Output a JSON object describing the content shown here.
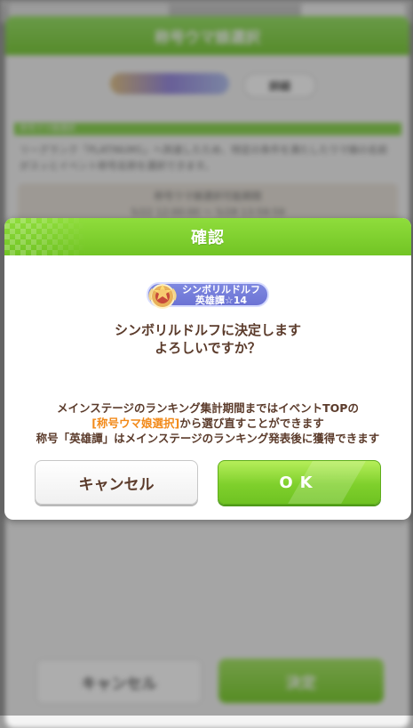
{
  "background_dialog": {
    "title": "称号ウマ娘選択",
    "detail_button": "詳細",
    "section_label": "称号ウマ娘選択",
    "description": "リーグランク「PLATINUM1」へ到達したため、特定の条件を満たしたウマ娘の名前がスッとイベント称号名称を選択できます。",
    "period_label": "称号ウマ娘選択可能期間",
    "period_value": "5/22 12:00:00 ～ 5/28 13:59:59",
    "cancel_button": "キャンセル",
    "confirm_button": "決定"
  },
  "modal": {
    "title": "確認",
    "badge": {
      "name": "シンボリルドルフ",
      "rank": "英雄譚☆14"
    },
    "confirm_line1": "シンボリルドルフに決定します",
    "confirm_line2": "よろしいですか？",
    "notice_line1": "メインステージのランキング集計期間まではイベントTOPの",
    "notice_link": "[称号ウマ娘選択]",
    "notice_line2_rest": "から選び直すことができます",
    "notice_line3": "称号「英雄譚」はメインステージのランキング発表後に獲得できます",
    "cancel_button": "キャンセル",
    "ok_button": "OK"
  },
  "colors": {
    "header_green": "#7fcd3f",
    "ok_green": "#7fd02c",
    "text_brown": "#5b3b2b",
    "link_orange": "#f28a1a"
  }
}
